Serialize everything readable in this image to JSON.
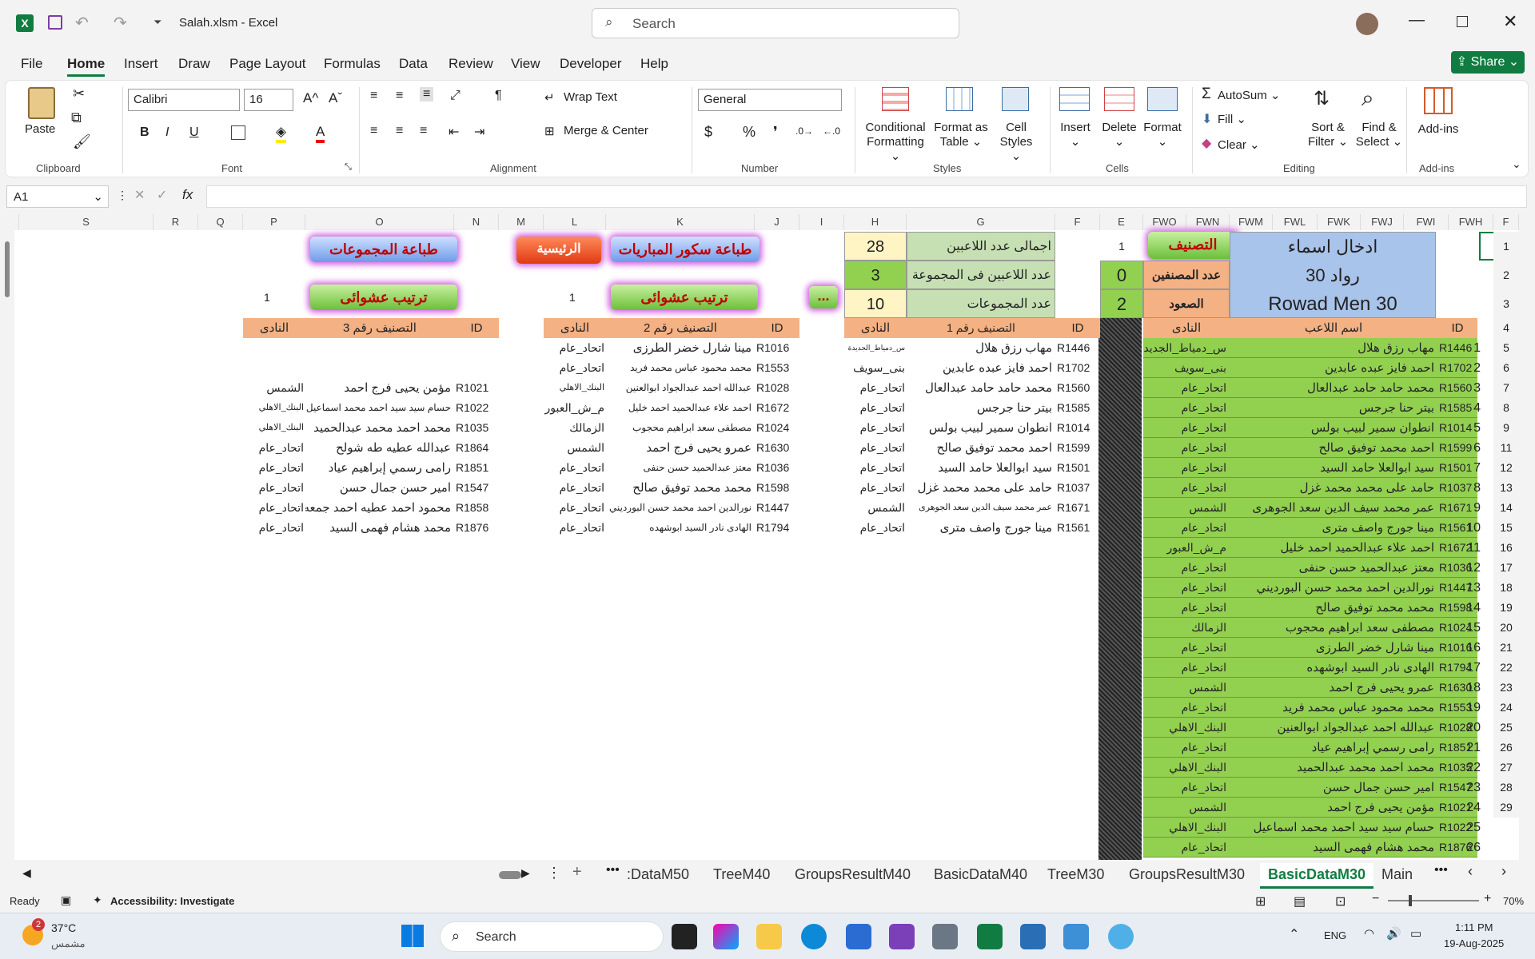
{
  "window": {
    "file": "Salah.xlsm",
    "sep": "-",
    "app": "Excel",
    "search_placeholder": "Search"
  },
  "menu": [
    "File",
    "Home",
    "Insert",
    "Draw",
    "Page Layout",
    "Formulas",
    "Data",
    "Review",
    "View",
    "Developer",
    "Help"
  ],
  "share": "Share",
  "ribbon": {
    "clipboard": {
      "paste": "Paste",
      "label": "Clipboard"
    },
    "font": {
      "name": "Calibri",
      "size": "16",
      "label": "Font"
    },
    "alignment": {
      "wrap": "Wrap Text",
      "merge": "Merge & Center",
      "label": "Alignment"
    },
    "number": {
      "format": "General",
      "label": "Number"
    },
    "styles": {
      "conditional": "Conditional",
      "formatting": "Formatting",
      "format_as": "Format as",
      "table": "Table",
      "cell": "Cell",
      "cell_styles": "Styles",
      "label": "Styles"
    },
    "cells": {
      "insert": "Insert",
      "delete": "Delete",
      "format": "Format",
      "label": "Cells"
    },
    "editing": {
      "autosum": "AutoSum",
      "fill": "Fill",
      "clear": "Clear",
      "sort": "Sort &",
      "filter": "Filter",
      "find": "Find &",
      "select": "Select",
      "label": "Editing"
    },
    "addins": {
      "btn": "Add-ins",
      "label": "Add-ins"
    }
  },
  "formula_bar": {
    "name_box": "A1",
    "fx": "fx",
    "content": ""
  },
  "columns": [
    "S",
    "R",
    "Q",
    "P",
    "O",
    "N",
    "M",
    "L",
    "K",
    "J",
    "I",
    "H",
    "G",
    "F",
    "E",
    "FWO",
    "FWN",
    "FWM",
    "FWL",
    "FWK",
    "FWJ",
    "FWI",
    "FWH",
    "F"
  ],
  "top": {
    "btn_print_groups": "طباعة المجموعات",
    "btn_home": "الرئيسية",
    "btn_print_scores": "طباعة سكور المباريات",
    "btn_random1": "ترتيب عشوائى",
    "btn_random2": "ترتيب عشوائى",
    "btn_dots": "...",
    "p_val": "1",
    "l_val": "1",
    "total_label": "اجمالى عدد اللاعبين",
    "total_val": "28",
    "per_group_label": "عدد اللاعبين فى المجموعة",
    "per_group_val": "3",
    "groups_label": "عدد المجموعات",
    "groups_val": "10",
    "e1": "1",
    "e2": "0",
    "e3": "2",
    "classify_btn": "التصنيف",
    "classified_label": "عدد المصنفين",
    "promo_label": "الصعود",
    "title1": "ادخال اسماء",
    "title2": "رواد 30",
    "title3": "Rowad Men 30"
  },
  "headers": {
    "club": "النادى",
    "cls3": "التصنيف رقم 3",
    "cls2": "التصنيف رقم 2",
    "cls1": "التصنيف رقم 1",
    "id": "ID",
    "player": "اسم اللاعب"
  },
  "rownums": [
    "1",
    "2",
    "3",
    "4",
    "5",
    "6",
    "7",
    "8",
    "9",
    "11",
    "12",
    "13",
    "14",
    "15",
    "16",
    "17",
    "18",
    "19",
    "20",
    "21",
    "22",
    "23",
    "24",
    "25",
    "26",
    "27",
    "28",
    "29"
  ],
  "group1": [
    [
      "R1446",
      "مهاب رزق هلال",
      "س_دمياط_الجديدة"
    ],
    [
      "R1702",
      "احمد فايز عبده عابدين",
      "بنى_سويف"
    ],
    [
      "R1560",
      "محمد حامد حامد عبدالعال",
      "اتحاد_عام"
    ],
    [
      "R1585",
      "بيتر حنا جرجس",
      "اتحاد_عام"
    ],
    [
      "R1014",
      "انطوان سمير لبيب بولس",
      "اتحاد_عام"
    ],
    [
      "R1599",
      "احمد محمد توفيق صالح",
      "اتحاد_عام"
    ],
    [
      "R1501",
      "سيد ابوالعلا حامد السيد",
      "اتحاد_عام"
    ],
    [
      "R1037",
      "حامد على محمد محمد غزل",
      "اتحاد_عام"
    ],
    [
      "R1671",
      "عمر محمد سيف الدين سعد الجوهرى",
      "الشمس"
    ],
    [
      "R1561",
      "مينا جورج واصف مترى",
      "اتحاد_عام"
    ]
  ],
  "group2": [
    [
      "R1016",
      "مينا شارل خضر الطرزى",
      "اتحاد_عام"
    ],
    [
      "R1553",
      "محمد محمود عباس محمد فريد",
      "اتحاد_عام"
    ],
    [
      "R1028",
      "عبدالله احمد عبدالجواد ابوالعنين",
      "البنك_الاهلي"
    ],
    [
      "R1672",
      "احمد علاء عبدالحميد احمد خليل",
      "م_ش_العبور"
    ],
    [
      "R1024",
      "مصطفى سعد ابراهيم محجوب",
      "الزمالك"
    ],
    [
      "R1630",
      "عمرو يحيى فرج احمد",
      "الشمس"
    ],
    [
      "R1036",
      "معتز عبدالحميد حسن حنفى",
      "اتحاد_عام"
    ],
    [
      "R1598",
      "محمد محمد توفيق صالح",
      "اتحاد_عام"
    ],
    [
      "R1447",
      "نورالدين احمد محمد حسن البورديني",
      "اتحاد_عام"
    ],
    [
      "R1794",
      "الهادى نادر السيد ابوشهده",
      "اتحاد_عام"
    ]
  ],
  "group3": [
    [
      "R1021",
      "مؤمن يحيى فرج احمد",
      "الشمس"
    ],
    [
      "R1022",
      "حسام سيد سيد احمد محمد اسماعيل",
      "البنك_الاهلي"
    ],
    [
      "R1035",
      "محمد احمد محمد عبدالحميد",
      "البنك_الاهلي"
    ],
    [
      "R1864",
      "عبدالله عطيه طه شولح",
      "اتحاد_عام"
    ],
    [
      "R1851",
      "رامى رسمي إبراهيم عياد",
      "اتحاد_عام"
    ],
    [
      "R1547",
      "امير حسن جمال حسن",
      "اتحاد_عام"
    ],
    [
      "R1858",
      "محمود احمد عطيه احمد جمعه",
      "اتحاد_عام"
    ],
    [
      "R1876",
      "محمد هشام فهمى السيد",
      "اتحاد_عام"
    ]
  ],
  "players": [
    [
      "1",
      "R1446",
      "مهاب رزق هلال",
      "س_دمياط_الجديدة"
    ],
    [
      "2",
      "R1702",
      "احمد فايز عبده عابدين",
      "بنى_سويف"
    ],
    [
      "3",
      "R1560",
      "محمد حامد حامد عبدالعال",
      "اتحاد_عام"
    ],
    [
      "4",
      "R1585",
      "بيتر حنا جرجس",
      "اتحاد_عام"
    ],
    [
      "5",
      "R1014",
      "انطوان سمير لبيب بولس",
      "اتحاد_عام"
    ],
    [
      "6",
      "R1599",
      "احمد محمد توفيق صالح",
      "اتحاد_عام"
    ],
    [
      "7",
      "R1501",
      "سيد ابوالعلا حامد السيد",
      "اتحاد_عام"
    ],
    [
      "8",
      "R1037",
      "حامد على محمد محمد غزل",
      "اتحاد_عام"
    ],
    [
      "9",
      "R1671",
      "عمر محمد سيف الدين سعد الجوهرى",
      "الشمس"
    ],
    [
      "10",
      "R1561",
      "مينا جورج واصف مترى",
      "اتحاد_عام"
    ],
    [
      "11",
      "R1672",
      "احمد علاء عبدالحميد احمد خليل",
      "م_ش_العبور"
    ],
    [
      "12",
      "R1036",
      "معتز عبدالحميد حسن حنفى",
      "اتحاد_عام"
    ],
    [
      "13",
      "R1447",
      "نورالدين احمد محمد حسن البورديني",
      "اتحاد_عام"
    ],
    [
      "14",
      "R1598",
      "محمد محمد توفيق صالح",
      "اتحاد_عام"
    ],
    [
      "15",
      "R1024",
      "مصطفى سعد ابراهيم محجوب",
      "الزمالك"
    ],
    [
      "16",
      "R1016",
      "مينا شارل خضر الطرزى",
      "اتحاد_عام"
    ],
    [
      "17",
      "R1794",
      "الهادى نادر السيد ابوشهده",
      "اتحاد_عام"
    ],
    [
      "18",
      "R1630",
      "عمرو يحيى فرج احمد",
      "الشمس"
    ],
    [
      "19",
      "R1553",
      "محمد محمود عباس محمد فريد",
      "اتحاد_عام"
    ],
    [
      "20",
      "R1028",
      "عبدالله احمد عبدالجواد ابوالعنين",
      "البنك_الاهلي"
    ],
    [
      "21",
      "R1851",
      "رامى رسمي إبراهيم عياد",
      "اتحاد_عام"
    ],
    [
      "22",
      "R1035",
      "محمد احمد محمد عبدالحميد",
      "البنك_الاهلي"
    ],
    [
      "23",
      "R1547",
      "امير حسن جمال حسن",
      "اتحاد_عام"
    ],
    [
      "24",
      "R1021",
      "مؤمن يحيى فرج احمد",
      "الشمس"
    ],
    [
      "25",
      "R1022",
      "حسام سيد سيد احمد محمد اسماعيل",
      "البنك_الاهلي"
    ],
    [
      "26",
      "R1876",
      "محمد هشام فهمى السيد",
      "اتحاد_عام"
    ]
  ],
  "tabs": [
    ":DataM50",
    "TreeM40",
    "GroupsResultM40",
    "BasicDataM40",
    "TreeM30",
    "GroupsResultM30",
    "BasicDataM30",
    "Main"
  ],
  "active_tab": "BasicDataM30",
  "status": {
    "ready": "Ready",
    "accessibility": "Accessibility: Investigate",
    "zoom": "70%"
  },
  "taskbar": {
    "temp": "37°C",
    "weather": "مشمس",
    "badge": "2",
    "search": "Search",
    "lang": "ENG",
    "time": "1:11 PM",
    "date": "19-Aug-2025"
  },
  "colors": {
    "green": "#92d050",
    "salmon": "#f4b183",
    "blue": "#a9c4eb",
    "accent": "#107c41"
  }
}
